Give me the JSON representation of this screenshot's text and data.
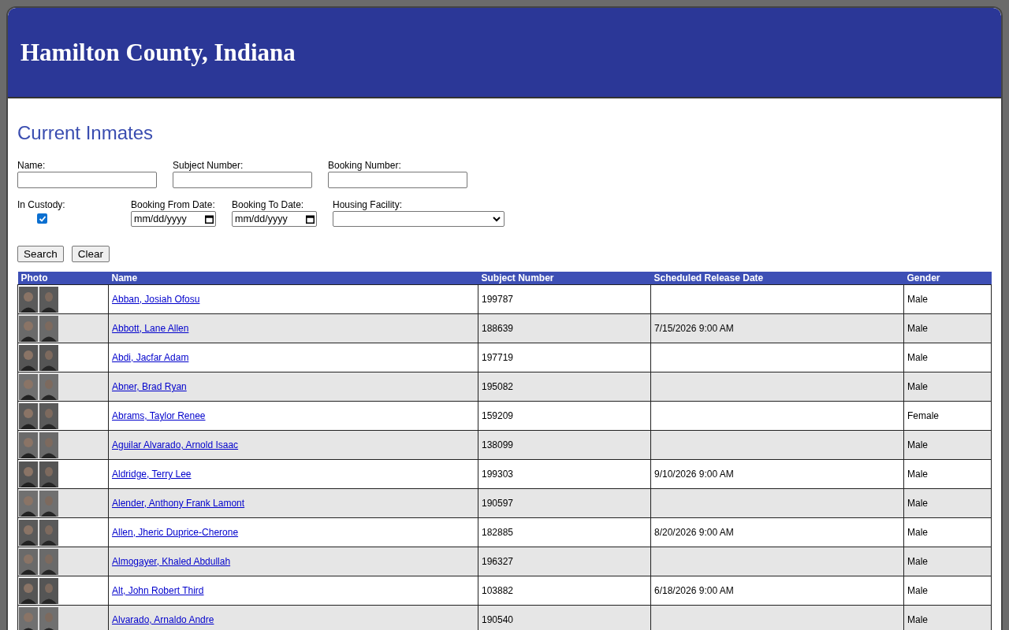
{
  "header": {
    "title": "Hamilton County, Indiana"
  },
  "page_title": "Current Inmates",
  "filters": {
    "name": {
      "label": "Name:"
    },
    "subject_number": {
      "label": "Subject Number:"
    },
    "booking_number": {
      "label": "Booking Number:"
    },
    "in_custody": {
      "label": "In Custody:",
      "checked": true
    },
    "booking_from_date": {
      "label": "Booking From Date:",
      "placeholder": "mm/dd/yyyy"
    },
    "booking_to_date": {
      "label": "Booking To Date:",
      "placeholder": "mm/dd/yyyy"
    },
    "housing_facility": {
      "label": "Housing Facility:"
    }
  },
  "buttons": [
    "Search",
    "Clear"
  ],
  "table": {
    "columns": [
      "Photo",
      "Name",
      "Subject Number",
      "Scheduled Release Date",
      "Gender"
    ],
    "rows": [
      {
        "name": "Abban, Josiah Ofosu",
        "subject_number": "199787",
        "gender": "Male"
      },
      {
        "name": "Abbott, Lane Allen",
        "subject_number": "188639",
        "release_date": "7/15/2026 9:00 AM",
        "gender": "Male"
      },
      {
        "name": "Abdi, Jacfar Adam",
        "subject_number": "197719",
        "gender": "Male"
      },
      {
        "name": "Abner, Brad Ryan",
        "subject_number": "195082",
        "gender": "Male"
      },
      {
        "name": "Abrams, Taylor Renee",
        "subject_number": "159209",
        "gender": "Female"
      },
      {
        "name": "Aguilar Alvarado, Arnold Isaac",
        "subject_number": "138099",
        "gender": "Male"
      },
      {
        "name": "Aldridge, Terry Lee",
        "subject_number": "199303",
        "release_date": "9/10/2026 9:00 AM",
        "gender": "Male"
      },
      {
        "name": "Alender, Anthony Frank Lamont",
        "subject_number": "190597",
        "gender": "Male"
      },
      {
        "name": "Allen, Jheric Duprice-Cherone",
        "subject_number": "182885",
        "release_date": "8/20/2026 9:00 AM",
        "gender": "Male"
      },
      {
        "name": "Almogayer, Khaled Abdullah",
        "subject_number": "196327",
        "gender": "Male"
      },
      {
        "name": "Alt, John Robert Third",
        "subject_number": "103882",
        "release_date": "6/18/2026 9:00 AM",
        "gender": "Male"
      },
      {
        "name": "Alvarado, Arnaldo Andre",
        "subject_number": "190540",
        "gender": "Male"
      }
    ]
  }
}
